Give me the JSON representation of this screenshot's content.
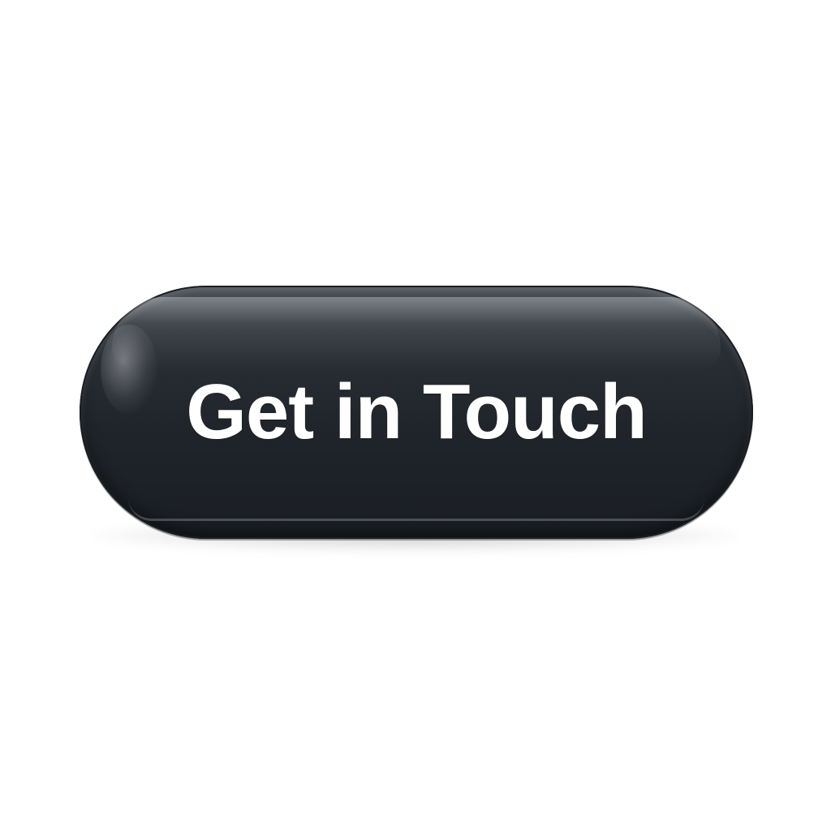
{
  "button": {
    "label": "Get in Touch",
    "background_color": "#20252b",
    "text_color": "#ffffff"
  },
  "page": {
    "background_color": "#ffffff"
  }
}
